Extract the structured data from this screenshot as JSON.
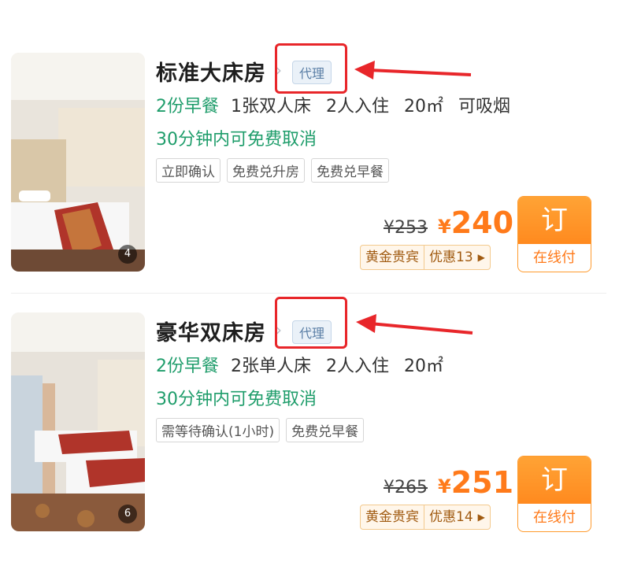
{
  "rooms": [
    {
      "name": "标准大床房",
      "agent_badge": "代理",
      "breakfast": "2份早餐",
      "bed": "1张双人床",
      "occupancy": "2人入住",
      "area": "20㎡",
      "smoking": "可吸烟",
      "cancel_policy": "30分钟内可免费取消",
      "tags": [
        "立即确认",
        "免费兑升房",
        "免费兑早餐"
      ],
      "original_price": "¥253",
      "currency": "¥",
      "price": "240",
      "vip_label": "黄金贵宾",
      "vip_discount": "优惠13",
      "book_label": "订",
      "pay_label": "在线付",
      "photo_count": "4"
    },
    {
      "name": "豪华双床房",
      "agent_badge": "代理",
      "breakfast": "2份早餐",
      "bed": "2张单人床",
      "occupancy": "2人入住",
      "area": "20㎡",
      "cancel_policy": "30分钟内可免费取消",
      "tags": [
        "需等待确认(1小时)",
        "免费兑早餐"
      ],
      "original_price": "¥265",
      "currency": "¥",
      "price": "251",
      "vip_label": "黄金贵宾",
      "vip_discount": "优惠14",
      "book_label": "订",
      "pay_label": "在线付",
      "photo_count": "6"
    }
  ],
  "icons": {
    "vip_arrow": "caret-right-icon",
    "chevron": "chevron-right-icon",
    "annotation_arrow": "red-arrow-icon"
  },
  "colors": {
    "price": "#ff7a1a",
    "green": "#1f9d6b",
    "annotation": "#e8262a"
  }
}
